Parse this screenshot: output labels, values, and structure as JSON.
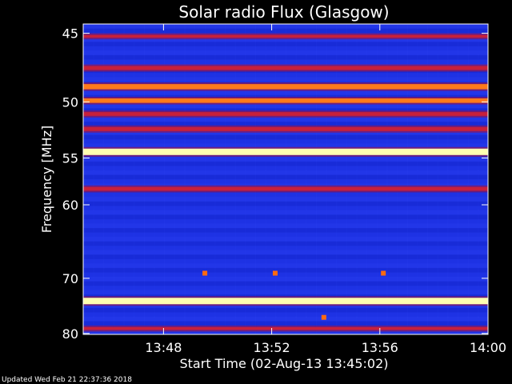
{
  "chart_data": {
    "type": "heatmap",
    "title": "Solar radio Flux (Glasgow)",
    "xlabel": "Start Time (02-Aug-13 13:45:02)",
    "ylabel": "Frequency [MHz]",
    "x_ticks": [
      "13:48",
      "13:52",
      "13:56",
      "14:00"
    ],
    "x_tick_minutes": [
      2.97,
      6.97,
      10.97,
      14.97
    ],
    "x_range_minutes": [
      0,
      14.97
    ],
    "y_ticks": [
      45,
      50,
      55,
      60,
      70,
      80
    ],
    "y_range_mhz": [
      44.4,
      80.2
    ],
    "y_scale": "reciprocal",
    "background_color": "#1a2fe0",
    "bands": [
      {
        "freq": 45.2,
        "intensity": 0.25
      },
      {
        "freq": 47.4,
        "intensity": 0.5
      },
      {
        "freq": 48.8,
        "intensity": 0.75
      },
      {
        "freq": 49.9,
        "intensity": 0.6
      },
      {
        "freq": 51.0,
        "intensity": 0.45
      },
      {
        "freq": 52.3,
        "intensity": 0.5
      },
      {
        "freq": 54.4,
        "intensity": 1.0
      },
      {
        "freq": 58.2,
        "intensity": 0.45
      },
      {
        "freq": 73.8,
        "intensity": 1.0
      },
      {
        "freq": 79.0,
        "intensity": 0.25
      }
    ],
    "bursts": [
      {
        "time_min": 8.9,
        "freq": 76.8
      },
      {
        "time_min": 4.5,
        "freq": 69.2
      },
      {
        "time_min": 7.1,
        "freq": 69.2
      },
      {
        "time_min": 11.1,
        "freq": 69.2
      }
    ]
  },
  "footer": {
    "updated": "Updated Wed Feb 21 22:37:36 2018"
  }
}
